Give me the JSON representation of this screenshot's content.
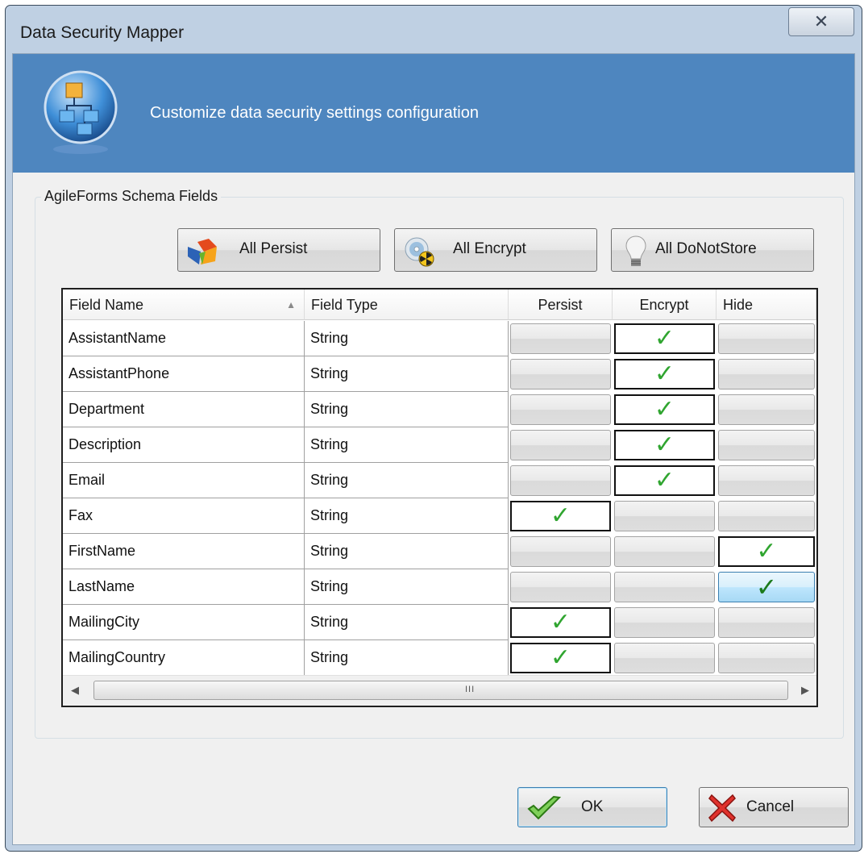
{
  "window": {
    "title": "Data Security Mapper",
    "close_glyph": "✕"
  },
  "banner": {
    "text": "Customize data security settings configuration",
    "icon": "hierarchy-icon"
  },
  "group": {
    "label": "AgileForms Schema Fields"
  },
  "toolbar": {
    "all_persist": "All Persist",
    "all_encrypt": "All Encrypt",
    "all_donotstore": "All DoNotStore"
  },
  "grid": {
    "columns": [
      "Field Name",
      "Field Type",
      "Persist",
      "Encrypt",
      "Hide"
    ],
    "sort_column": "Field Name",
    "sort_glyph": "▲",
    "check_glyph": "✓",
    "scroll_left": "◀",
    "scroll_right": "▶",
    "scroll_grip": "III",
    "rows": [
      {
        "name": "AssistantName",
        "type": "String",
        "persist": false,
        "encrypt": true,
        "hide": false
      },
      {
        "name": "AssistantPhone",
        "type": "String",
        "persist": false,
        "encrypt": true,
        "hide": false
      },
      {
        "name": "Department",
        "type": "String",
        "persist": false,
        "encrypt": true,
        "hide": false
      },
      {
        "name": "Description",
        "type": "String",
        "persist": false,
        "encrypt": true,
        "hide": false
      },
      {
        "name": "Email",
        "type": "String",
        "persist": false,
        "encrypt": true,
        "hide": false
      },
      {
        "name": "Fax",
        "type": "String",
        "persist": true,
        "encrypt": false,
        "hide": false
      },
      {
        "name": "FirstName",
        "type": "String",
        "persist": false,
        "encrypt": false,
        "hide": true
      },
      {
        "name": "LastName",
        "type": "String",
        "persist": false,
        "encrypt": false,
        "hide": true
      },
      {
        "name": "MailingCity",
        "type": "String",
        "persist": true,
        "encrypt": false,
        "hide": false
      },
      {
        "name": "MailingCountry",
        "type": "String",
        "persist": true,
        "encrypt": false,
        "hide": false
      }
    ],
    "selected_row": 7
  },
  "footer": {
    "ok": "OK",
    "cancel": "Cancel"
  },
  "colors": {
    "banner": "#4e86bf",
    "check": "#30a530"
  }
}
